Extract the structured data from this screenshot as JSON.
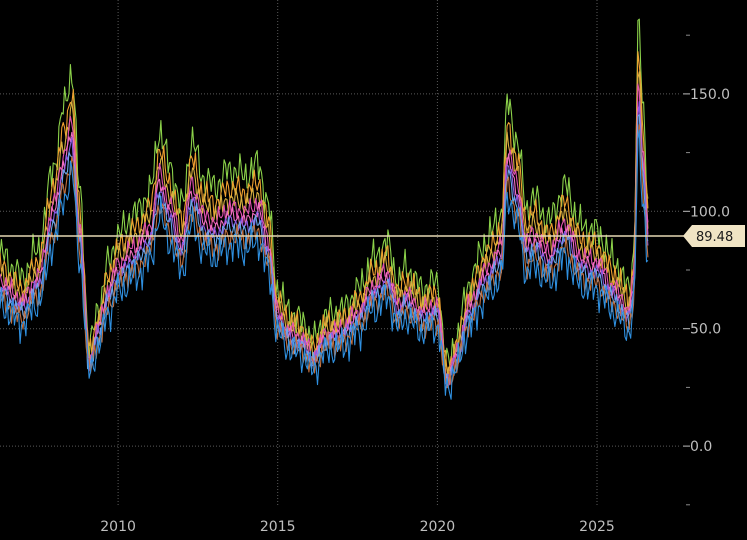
{
  "chart_data": {
    "type": "line",
    "title": "",
    "xlabel": "",
    "ylabel": "",
    "x_range": [
      2006.3,
      2027.6
    ],
    "ylim": [
      -40,
      190
    ],
    "grid": true,
    "x_ticks": [
      {
        "value": 2010,
        "label": "2010"
      },
      {
        "value": 2015,
        "label": "2015"
      },
      {
        "value": 2020,
        "label": "2020"
      },
      {
        "value": 2025,
        "label": "2025"
      }
    ],
    "y_ticks": [
      {
        "value": 150,
        "label": "150.0"
      },
      {
        "value": 100,
        "label": "100.0"
      },
      {
        "value": 50,
        "label": "50.0"
      },
      {
        "value": 0,
        "label": "0.0"
      }
    ],
    "current_value": {
      "value": 89.48,
      "label": "89.48"
    },
    "base_curve": {
      "x": [
        2006.3,
        2007.0,
        2007.5,
        2008.0,
        2008.3,
        2008.55,
        2008.8,
        2009.1,
        2009.4,
        2009.7,
        2010.0,
        2010.5,
        2011.0,
        2011.3,
        2011.6,
        2012.0,
        2012.3,
        2012.7,
        2013.0,
        2013.5,
        2014.0,
        2014.4,
        2014.7,
        2015.0,
        2015.3,
        2015.8,
        2016.1,
        2016.5,
        2017.0,
        2017.5,
        2018.0,
        2018.4,
        2018.8,
        2019.0,
        2019.5,
        2020.0,
        2020.3,
        2020.6,
        2021.0,
        2021.5,
        2022.0,
        2022.2,
        2022.5,
        2022.8,
        2023.0,
        2023.5,
        2024.0,
        2024.5,
        2025.0,
        2025.5,
        2026.0,
        2026.15,
        2026.3,
        2026.45,
        2026.6
      ],
      "y": [
        68,
        60,
        70,
        100,
        120,
        133,
        90,
        35,
        50,
        65,
        75,
        82,
        90,
        112,
        100,
        85,
        108,
        95,
        92,
        98,
        96,
        100,
        85,
        55,
        48,
        44,
        37,
        46,
        48,
        55,
        66,
        72,
        58,
        63,
        56,
        58,
        28,
        38,
        58,
        72,
        82,
        122,
        108,
        84,
        88,
        80,
        92,
        78,
        76,
        66,
        56,
        68,
        150,
        118,
        89.48
      ]
    },
    "series": [
      {
        "offset": 16,
        "noise": 9,
        "color": "#8cd24a"
      },
      {
        "offset": 10,
        "noise": 7,
        "color": "#f0a030"
      },
      {
        "offset": 6,
        "noise": 6,
        "color": "#d8b040"
      },
      {
        "offset": 3,
        "noise": 5,
        "color": "#e050b0"
      },
      {
        "offset": 0,
        "noise": 4,
        "color": "#f070c0"
      },
      {
        "offset": -2,
        "noise": 4,
        "color": "#8a5ae0"
      },
      {
        "offset": -4,
        "noise": 5,
        "color": "#6aa8e8"
      },
      {
        "offset": -7,
        "noise": 6,
        "color": "#c07040"
      },
      {
        "offset": -10,
        "noise": 9,
        "color": "#2f90e0"
      }
    ],
    "colors": {
      "background": "#000000",
      "grid": "#5a5a5a",
      "price_line": "#e6d7b4",
      "price_label_bg": "#f0e4c4",
      "tick_text": "#bfbfbf"
    }
  }
}
